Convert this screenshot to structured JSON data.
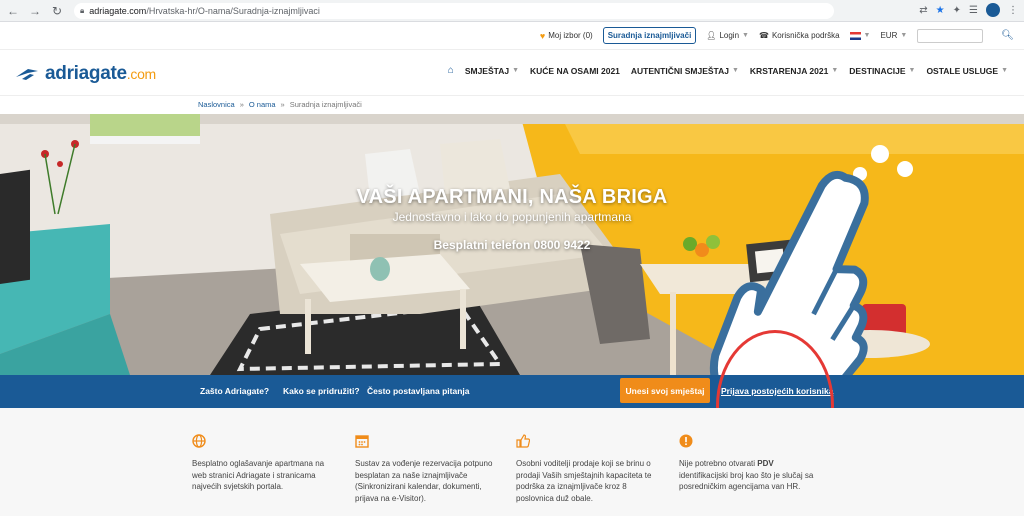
{
  "browser": {
    "url_host": "adriagate.com",
    "url_path": "/Hrvatska-hr/O-nama/Suradnja-iznajmljivaci"
  },
  "utility": {
    "favorites": "Moj izbor (0)",
    "partner_button": "Suradnja iznajmljivači",
    "login": "Login",
    "support": "Korisnička podrška",
    "currency": "EUR"
  },
  "header": {
    "logo_name": "adriagate",
    "logo_suffix": ".com",
    "nav": [
      "SMJEŠTAJ",
      "KUĆE NA OSAMI 2021",
      "AUTENTIČNI SMJEŠTAJ",
      "KRSTARENJA 2021",
      "DESTINACIJE",
      "OSTALE USLUGE"
    ]
  },
  "breadcrumb": [
    "Naslovnica",
    "O nama",
    "Suradnja iznajmljivači"
  ],
  "hero": {
    "title": "VAŠI APARTMANI, NAŠA BRIGA",
    "subtitle": "Jednostavno i lako do popunjenih apartmana",
    "phone": "Besplatni telefon 0800 9422"
  },
  "tabs": {
    "why": "Zašto Adriagate?",
    "how": "Kako se pridružiti?",
    "faq": "Često postavljana pitanja",
    "cta": "Unesi svoj smještaj",
    "login": "Prijava postojećih korisnika"
  },
  "features": [
    {
      "icon": "globe-icon",
      "text": "Besplatno oglašavanje apartmana na web stranici Adriagate i stranicama najvećih svjetskih portala."
    },
    {
      "icon": "calendar-icon",
      "text": "Sustav za vođenje rezervacija potpuno besplatan za naše iznajmljivače (Sinkronizirani kalendar, dokumenti, prijava na e-Visitor)."
    },
    {
      "icon": "thumbs-up-icon",
      "text": "Osobni voditelji prodaje koji se brinu o prodaji Vaših smještajnih kapaciteta te podrška za iznajmljivače kroz 8 poslovnica duž obale."
    },
    {
      "icon": "alert-icon",
      "text_pre": "Nije potrebno otvarati ",
      "text_bold": "PDV",
      "text_post": " identifikacijski broj kao što je slučaj sa posredničkim agencijama van HR."
    }
  ],
  "colors": {
    "brand_blue": "#1a5a96",
    "accent_orange": "#f08c1a",
    "annotation_red": "#e53935"
  }
}
